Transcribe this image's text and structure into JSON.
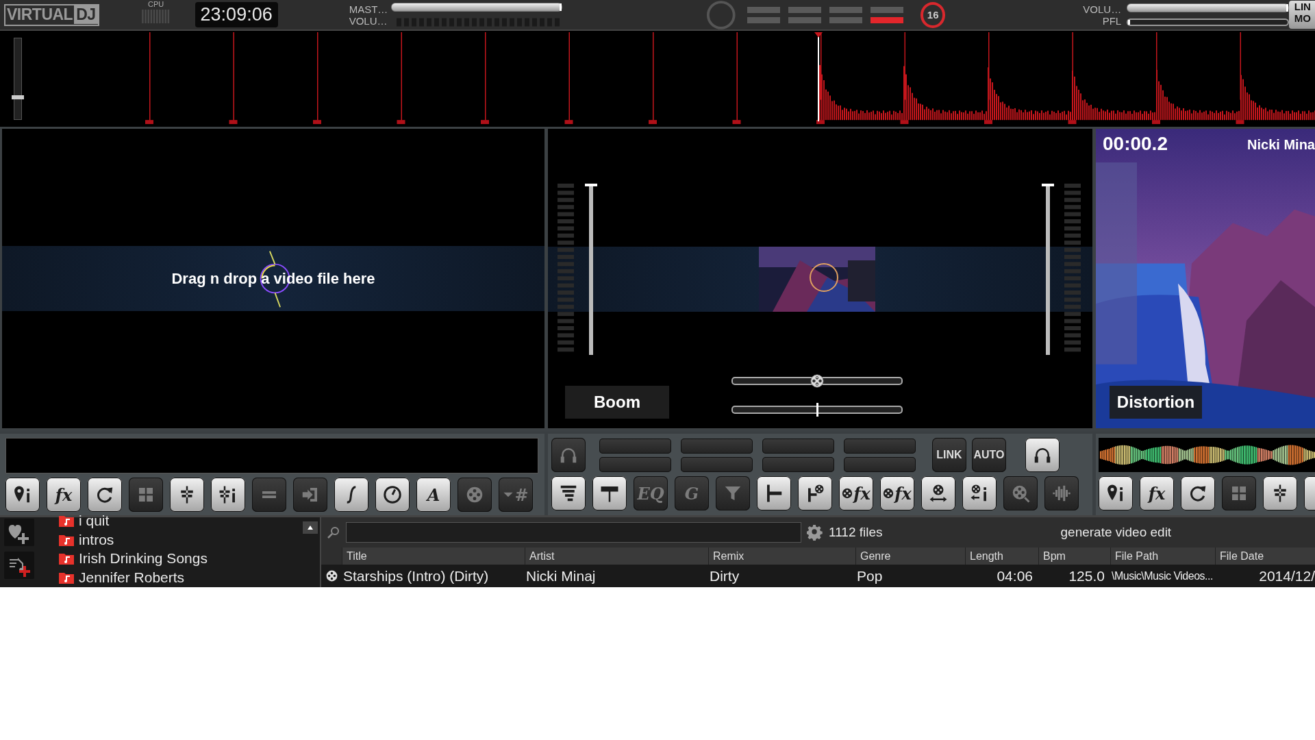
{
  "top_bar": {
    "logo": {
      "part_1": "VIRTUAL",
      "part_2": "DJ"
    },
    "cpu": {
      "label": "CPU"
    },
    "clock": "23:09:06",
    "master_labels": [
      "MAST…",
      "VOLU…"
    ],
    "master_volume": {
      "level": 1
    },
    "beat_leds": [
      {
        "on": false
      },
      {
        "on": false
      },
      {
        "on": false
      },
      {
        "on": false
      },
      {
        "on": false
      },
      {
        "on": false
      },
      {
        "on": false
      },
      {
        "on": true
      }
    ],
    "beat_count": "16",
    "right_labels": [
      "VOLU…",
      "PFL"
    ],
    "volume": {
      "level": 1
    },
    "pfl": {
      "level": 0
    },
    "mode_labels": [
      "LIN",
      "MO"
    ]
  },
  "waveform": {
    "zoom_slider": {
      "level": 0.25
    }
  },
  "videos": {
    "left": {
      "hint": "Drag n drop a video file here"
    },
    "mixer": {
      "left_fader": {
        "level": 1
      },
      "right_fader": {
        "level": 1
      },
      "transition": "Boom",
      "transition_slider": {
        "level": 0.5
      },
      "effect_slider": {
        "level": 0.5
      }
    },
    "right": {
      "time": "00:00.2",
      "artist": "Nicki Mina",
      "effect": "Distortion"
    }
  },
  "controls": {
    "left_deck": {
      "buttons": [
        {
          "on": true
        },
        {
          "label": "fx",
          "on": true
        },
        {
          "on": true
        },
        {
          "on": false
        },
        {
          "on": true
        },
        {
          "on": true
        },
        {
          "on": false
        },
        {
          "on": false
        },
        {
          "on": true
        },
        {
          "on": true
        },
        {
          "label": "A",
          "on": true
        },
        {
          "on": false
        },
        {
          "label": "#",
          "on": false
        }
      ]
    },
    "mixer": {
      "pfl_left": {
        "on": false
      },
      "link": {
        "label": "LINK",
        "on": false
      },
      "auto": {
        "label": "AUTO",
        "on": false
      },
      "pfl_right": {
        "on": true
      },
      "buttons": [
        {
          "on": true
        },
        {
          "on": true
        },
        {
          "label": "EQ",
          "on": false
        },
        {
          "label": "G",
          "on": false
        },
        {
          "on": false
        },
        {
          "on": true
        },
        {
          "on": true
        },
        {
          "label": "fx",
          "on": true
        },
        {
          "label": "fx",
          "on": true
        },
        {
          "on": true
        },
        {
          "on": true
        },
        {
          "on": false
        },
        {
          "on": false
        }
      ]
    },
    "right_deck": {
      "buttons": [
        {
          "on": true
        },
        {
          "label": "fx",
          "on": true
        },
        {
          "on": true
        },
        {
          "on": false
        },
        {
          "on": true
        },
        {
          "on": true
        }
      ]
    }
  },
  "browser": {
    "folders": [
      {
        "name": "i quit"
      },
      {
        "name": "intros"
      },
      {
        "name": "Irish Drinking Songs"
      },
      {
        "name": "Jennifer Roberts"
      }
    ],
    "file_count": "1112 files",
    "action": "generate video edit",
    "columns": [
      "Title",
      "Artist",
      "Remix",
      "Genre",
      "Length",
      "Bpm",
      "File Path",
      "File Date"
    ],
    "rows": [
      {
        "kind": "video",
        "cells": [
          "Starships (Intro) (Dirty)",
          "Nicki Minaj",
          "Dirty",
          "Pop",
          "04:06",
          "125.0",
          "\\Music\\Music Videos...",
          "2014/12/"
        ]
      }
    ]
  }
}
